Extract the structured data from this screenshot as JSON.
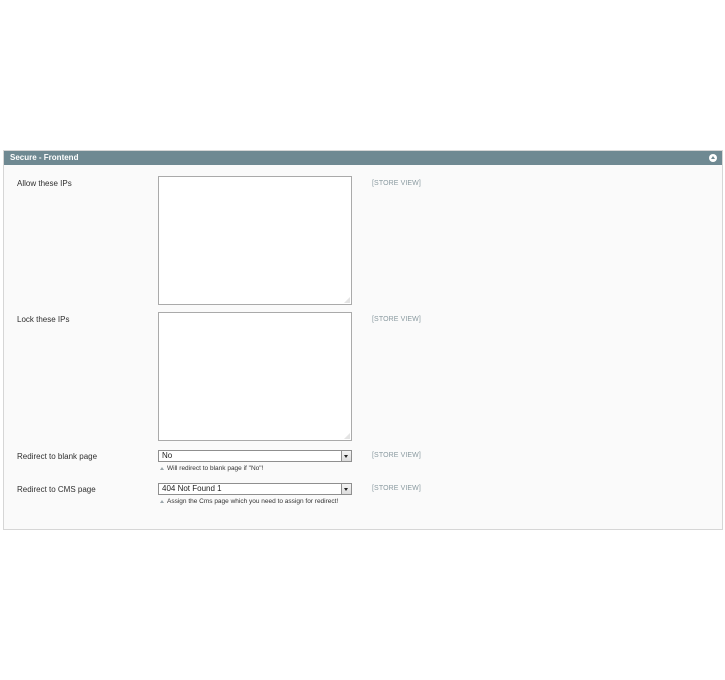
{
  "section": {
    "title": "Secure - Frontend",
    "collapse_icon": "collapse-up-icon"
  },
  "fields": {
    "allow_ips": {
      "label": "Allow these IPs",
      "value": "",
      "scope": "[STORE VIEW]"
    },
    "lock_ips": {
      "label": "Lock these IPs",
      "value": "",
      "scope": "[STORE VIEW]"
    },
    "redirect_blank": {
      "label": "Redirect to blank page",
      "selected": "No",
      "note": "Will redirect to blank page if \"No\"!",
      "scope": "[STORE VIEW]"
    },
    "redirect_cms": {
      "label": "Redirect to CMS page",
      "selected": "404 Not Found 1",
      "note": "Assign the Cms page which you need to assign for redirect!",
      "scope": "[STORE VIEW]"
    }
  },
  "colors": {
    "header_bg": "#6f8992",
    "panel_bg": "#fafafa",
    "scope_text": "#8a9aa0"
  }
}
